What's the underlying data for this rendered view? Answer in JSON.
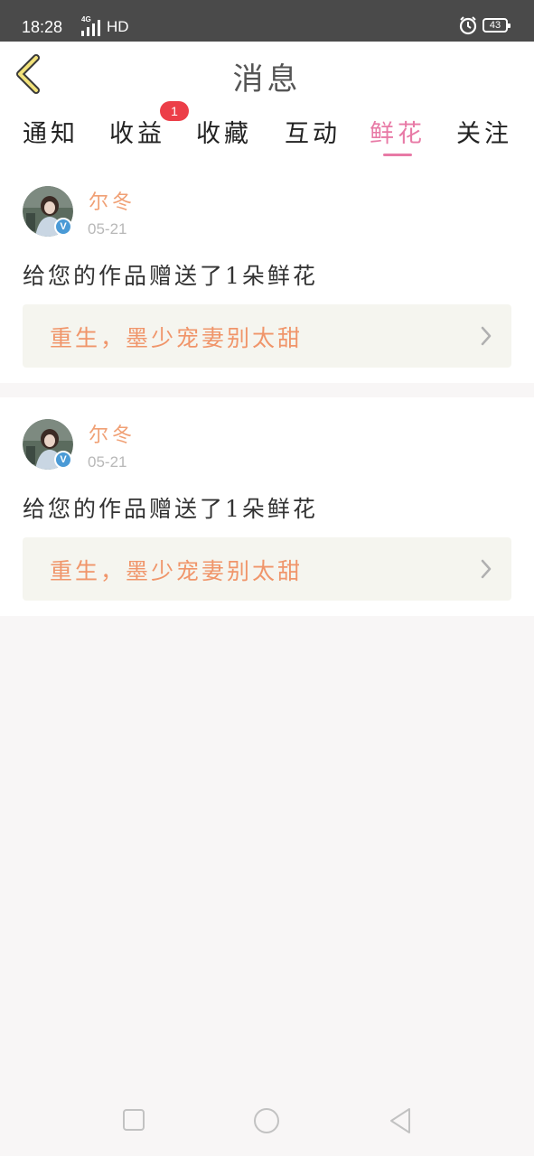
{
  "status_bar": {
    "time": "18:28",
    "network_type": "4G",
    "hd_label": "HD",
    "battery": "43",
    "icons": [
      "signal-icon",
      "alarm-icon",
      "battery-icon"
    ]
  },
  "header": {
    "title": "消息",
    "back_icon": "chevron-left-icon"
  },
  "tabs": [
    {
      "label": "通知",
      "active": false
    },
    {
      "label": "收益",
      "active": false,
      "badge": "1"
    },
    {
      "label": "收藏",
      "active": false
    },
    {
      "label": "互动",
      "active": false
    },
    {
      "label": "鲜花",
      "active": true
    },
    {
      "label": "关注",
      "active": false
    }
  ],
  "messages": [
    {
      "user": "尔冬",
      "date": "05-21",
      "verified_icon": "verified-badge-icon",
      "text": "给您的作品赠送了1朵鲜花",
      "work_title": "重生，墨少宠妻别太甜"
    },
    {
      "user": "尔冬",
      "date": "05-21",
      "verified_icon": "verified-badge-icon",
      "text": "给您的作品赠送了1朵鲜花",
      "work_title": "重生，墨少宠妻别太甜"
    }
  ],
  "colors": {
    "accent_pink": "#e87aa6",
    "username_orange": "#f0a075",
    "work_title_orange": "#f0956a",
    "badge_red": "#ec3e48",
    "status_bar": "#4a4a4a"
  },
  "nav_bar": {
    "icons": [
      "recent-apps-icon",
      "home-icon",
      "back-triangle-icon"
    ]
  }
}
